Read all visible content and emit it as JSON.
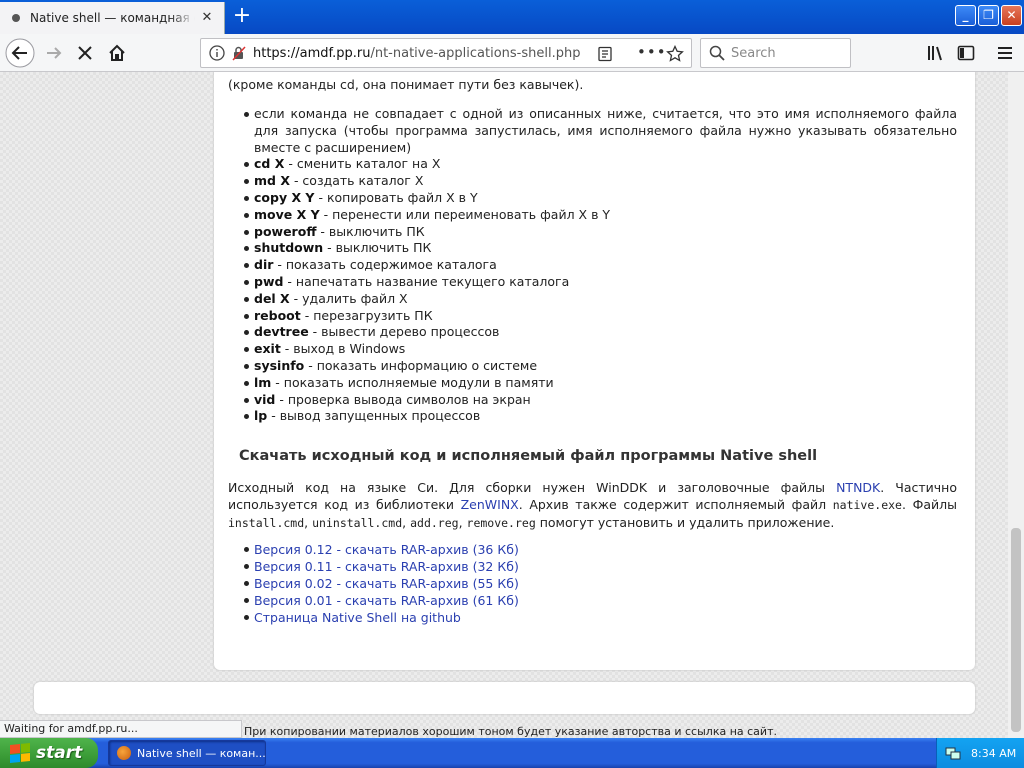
{
  "browser": {
    "tab_title": "Native shell — командная строка",
    "url_prefix": "https://amdf.pp.ru",
    "url_path": "/nt-native-applications-shell.php",
    "search_placeholder": "Search",
    "status_text": "Waiting for amdf.pp.ru..."
  },
  "article": {
    "intro_tail": "(кроме команды cd, она понимает пути без кавычек).",
    "first_item": "если команда не совпадает с одной из описанных ниже, считается, что это имя исполняемого файла для запуска (чтобы программа запустилась, имя исполняемого файла нужно указывать обязательно вместе с расширением)",
    "commands": [
      {
        "cmd": "cd X",
        "desc": " - сменить каталог на X"
      },
      {
        "cmd": "md X",
        "desc": " - создать каталог X"
      },
      {
        "cmd": "copy X Y",
        "desc": " - копировать файл X в Y"
      },
      {
        "cmd": "move X Y",
        "desc": " - перенести или переименовать файл X в Y"
      },
      {
        "cmd": "poweroff",
        "desc": " - выключить ПК"
      },
      {
        "cmd": "shutdown",
        "desc": " - выключить ПК"
      },
      {
        "cmd": "dir",
        "desc": " - показать содержимое каталога"
      },
      {
        "cmd": "pwd",
        "desc": " - напечатать название текущего каталога"
      },
      {
        "cmd": "del X",
        "desc": " - удалить файл X"
      },
      {
        "cmd": "reboot",
        "desc": " - перезагрузить ПК"
      },
      {
        "cmd": "devtree",
        "desc": " - вывести дерево процессов"
      },
      {
        "cmd": "exit",
        "desc": " - выход в Windows"
      },
      {
        "cmd": "sysinfo",
        "desc": " - показать информацию о системе"
      },
      {
        "cmd": "lm",
        "desc": " - показать исполняемые модули в памяти"
      },
      {
        "cmd": "vid",
        "desc": " - проверка вывода символов на экран"
      },
      {
        "cmd": "lp",
        "desc": " - вывод запущенных процессов"
      }
    ],
    "download_heading": "Скачать исходный код и исполняемый файл программы Native shell",
    "para": {
      "t1": "Исходный код на языке Си. Для сборки нужен WinDDK и заголовочные файлы ",
      "link1": "NTNDK",
      "t2": ". Частично используется код из библиотеки ",
      "link2": "ZenWINX",
      "t3": ". Архив также содержит исполняемый файл ",
      "code1": "native.exe",
      "t4": ". Файлы ",
      "code2": "install.cmd",
      "t5": ", ",
      "code3": "uninstall.cmd",
      "t6": ", ",
      "code4": "add.reg",
      "t7": ", ",
      "code5": "remove.reg",
      "t8": " помогут установить и удалить приложение."
    },
    "downloads": [
      "Версия 0.12 - скачать RAR-архив (36 Кб)",
      "Версия 0.11 - скачать RAR-архив (32 Кб)",
      "Версия 0.02 - скачать RAR-архив (55 Кб)",
      "Версия 0.01 - скачать RAR-архив (61 Кб)",
      "Страница Native Shell на github"
    ],
    "copyright": "При копировании материалов хорошим тоном будет указание авторства и ссылка на сайт."
  },
  "taskbar": {
    "start_label": "start",
    "task_title": "Native shell — коман...",
    "clock": "8:34 AM"
  },
  "colors": {
    "link": "#2a3fb0",
    "titlebar": "#0a5fd8",
    "start_green": "#3b9c37"
  }
}
